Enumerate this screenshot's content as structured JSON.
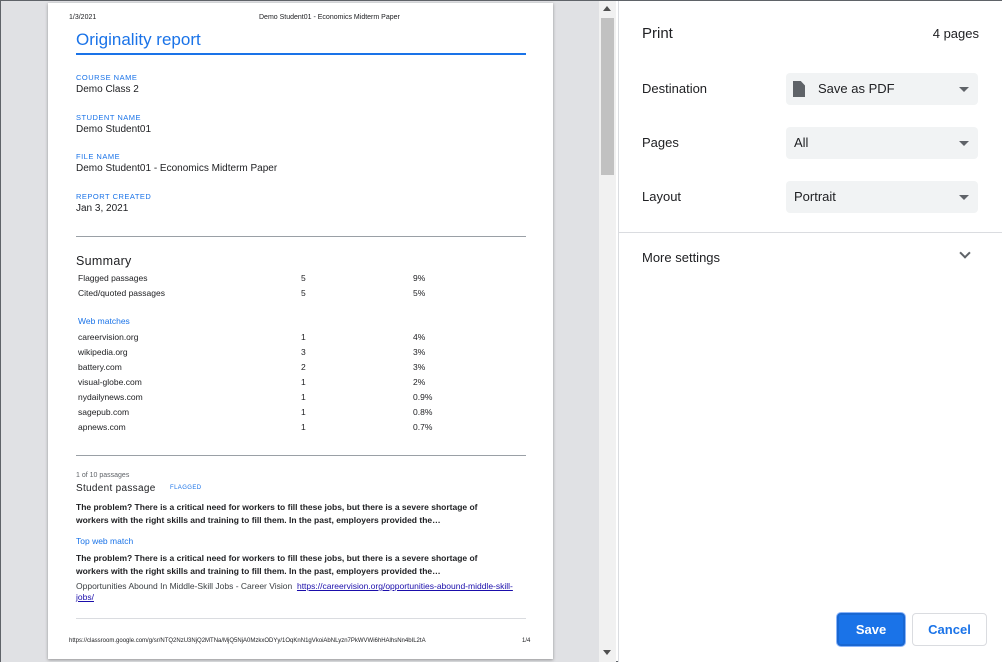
{
  "preview": {
    "header_date": "1/3/2021",
    "header_title": "Demo Student01 - Economics Midterm Paper",
    "report_title": "Originality report",
    "fields": [
      {
        "label": "COURSE NAME",
        "value": "Demo Class 2"
      },
      {
        "label": "STUDENT NAME",
        "value": "Demo Student01"
      },
      {
        "label": "FILE NAME",
        "value": "Demo Student01 - Economics Midterm Paper"
      },
      {
        "label": "REPORT CREATED",
        "value": "Jan 3, 2021"
      }
    ],
    "summary_title": "Summary",
    "summary_rows": [
      {
        "name": "Flagged passages",
        "count": "5",
        "pct": "9%"
      },
      {
        "name": "Cited/quoted passages",
        "count": "5",
        "pct": "5%"
      }
    ],
    "web_matches_label": "Web matches",
    "web_matches": [
      {
        "name": "careervision.org",
        "count": "1",
        "pct": "4%"
      },
      {
        "name": "wikipedia.org",
        "count": "3",
        "pct": "3%"
      },
      {
        "name": "battery.com",
        "count": "2",
        "pct": "3%"
      },
      {
        "name": "visual-globe.com",
        "count": "1",
        "pct": "2%"
      },
      {
        "name": "nydailynews.com",
        "count": "1",
        "pct": "0.9%"
      },
      {
        "name": "sagepub.com",
        "count": "1",
        "pct": "0.8%"
      },
      {
        "name": "apnews.com",
        "count": "1",
        "pct": "0.7%"
      }
    ],
    "passages_count": "1 of 10 passages",
    "student_passage_label": "Student passage",
    "flag_label": "FLAGGED",
    "student_passage_line1": "The problem? There is a critical need for workers to fill these jobs, but there is a severe shortage of",
    "student_passage_line2": "workers with the right skills and training to fill them. In the past, employers provided the…",
    "top_web_match_label": "Top web match",
    "web_passage_line1": "The problem? There is a critical need for workers to fill these jobs, but there is a severe shortage of",
    "web_passage_line2": "workers with the right skills and training to fill them. In the past, employers provided the…",
    "source_title": "Opportunities Abound In Middle-Skill Jobs - Career Vision",
    "source_url": "https://careervision.org/opportunities-abound-middle-skill-jobs/",
    "footer_url": "https://classroom.google.com/g/sr/NTQ2NzU3NjQ2MTNa/MjQ5NjA0MzkxODYy/1OqKnN1gVkoiAbNLyzn7PkWVWi6hHAlhsNn4bIL2tA",
    "page_number": "1/4"
  },
  "panel": {
    "title": "Print",
    "page_count": "4 pages",
    "destination_label": "Destination",
    "destination_value": "Save as PDF",
    "pages_label": "Pages",
    "pages_value": "All",
    "layout_label": "Layout",
    "layout_value": "Portrait",
    "more_settings_label": "More settings",
    "save_label": "Save",
    "cancel_label": "Cancel"
  },
  "colors": {
    "accent": "#1a73e8",
    "preview_background": "#e0e1e4",
    "select_background": "#f1f3f4"
  }
}
